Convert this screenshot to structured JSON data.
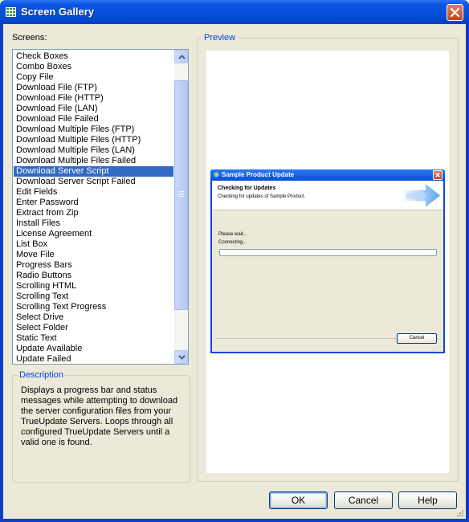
{
  "window": {
    "title": "Screen Gallery",
    "icon": "gallery-grid-icon"
  },
  "screens": {
    "label": "Screens:",
    "items": [
      "Check Boxes",
      "Combo Boxes",
      "Copy File",
      "Download File (FTP)",
      "Download File (HTTP)",
      "Download File (LAN)",
      "Download File Failed",
      "Download Multiple Files (FTP)",
      "Download Multiple Files (HTTP)",
      "Download Multiple Files (LAN)",
      "Download Multiple Files Failed",
      "Download Server Script",
      "Download Server Script Failed",
      "Edit Fields",
      "Enter Password",
      "Extract from Zip",
      "Install Files",
      "License Agreement",
      "List Box",
      "Move File",
      "Progress Bars",
      "Radio Buttons",
      "Scrolling HTML",
      "Scrolling Text",
      "Scrolling Text Progress",
      "Select Drive",
      "Select Folder",
      "Static Text",
      "Update Available",
      "Update Failed"
    ],
    "selected_index": 11
  },
  "description": {
    "label": "Description",
    "text": "Displays a progress bar and status messages while attempting to download the server configuration files from your TrueUpdate Servers. Loops through all configured TrueUpdate Servers until a valid one is found."
  },
  "preview": {
    "label": "Preview",
    "dialog": {
      "title": "Sample Product Update",
      "header_title": "Checking for Updates",
      "header_subtitle": "Checking for updates of Sample Product.",
      "wait_text": "Please wait...",
      "status_text": "Connecting...",
      "cancel_label": "Cancel",
      "progress": 0
    }
  },
  "buttons": {
    "ok": "OK",
    "cancel": "Cancel",
    "help": "Help"
  },
  "colors": {
    "titlebar": "#0650d8",
    "selection": "#316ac5",
    "group_title": "#0046d5",
    "face": "#ece9d8"
  }
}
